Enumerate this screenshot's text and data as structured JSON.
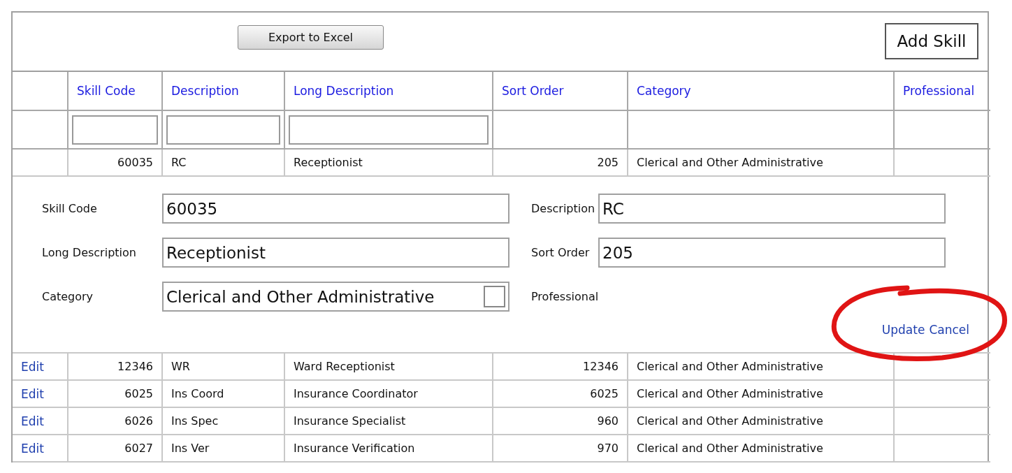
{
  "toolbar": {
    "export_button": "Export to Excel",
    "add_button": "Add Skill"
  },
  "table": {
    "columns": [
      {
        "label": "Skill Code",
        "filterable": true,
        "kind": "number"
      },
      {
        "label": "Description",
        "filterable": true,
        "kind": "text"
      },
      {
        "label": "Long Description",
        "filterable": true,
        "kind": "text"
      },
      {
        "label": "Sort Order",
        "filterable": false,
        "kind": "number"
      },
      {
        "label": "Category",
        "filterable": false,
        "kind": "text"
      },
      {
        "label": "Professional",
        "filterable": false,
        "kind": "text"
      }
    ],
    "editing_row": {
      "cells": [
        "60035",
        "RC",
        "Receptionist",
        "205",
        "Clerical and Other Administrative"
      ]
    },
    "edit_form": {
      "fields": [
        {
          "label": "Skill Code",
          "value": "60035"
        },
        {
          "label": "Description",
          "value": "RC"
        },
        {
          "label": "Long Description",
          "value": "Receptionist"
        },
        {
          "label": "Sort Order",
          "value": "205"
        },
        {
          "label": "Category",
          "value": "Clerical and Other Administrative",
          "checkbox": {
            "checked": false
          }
        },
        {
          "label": "Professional"
        }
      ],
      "actions": [
        "Update",
        "Cancel"
      ],
      "highlighted": true
    },
    "rows": [
      {
        "action": "Edit",
        "cells": [
          "12346",
          "WR",
          "Ward Receptionist",
          "12346",
          "Clerical and Other Administrative"
        ]
      },
      {
        "action": "Edit",
        "cells": [
          "6025",
          "Ins Coord",
          "Insurance Coordinator",
          "6025",
          "Clerical and Other Administrative"
        ]
      },
      {
        "action": "Edit",
        "cells": [
          "6026",
          "Ins Spec",
          "Insurance Specialist",
          "960",
          "Clerical and Other Administrative"
        ]
      },
      {
        "action": "Edit",
        "cells": [
          "6027",
          "Ins Ver",
          "Insurance Verification",
          "970",
          "Clerical and Other Administrative"
        ]
      }
    ]
  }
}
